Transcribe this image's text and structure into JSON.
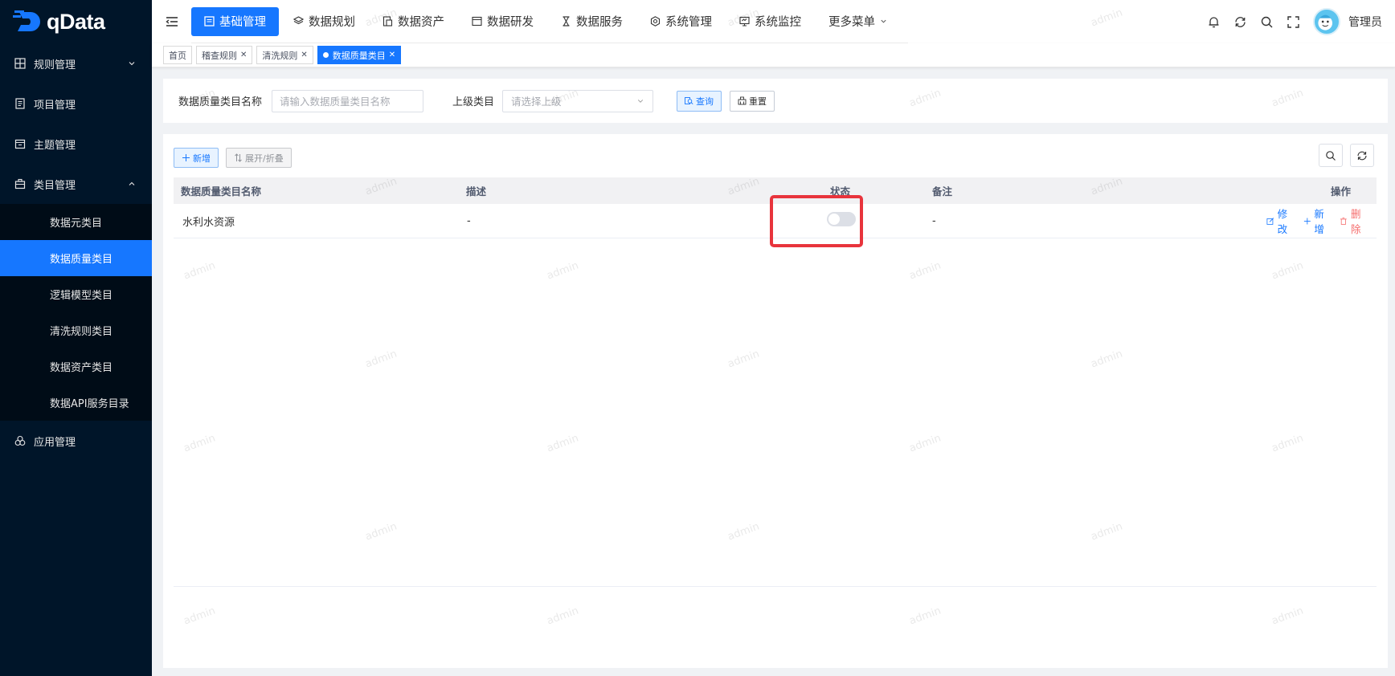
{
  "app": {
    "name": "qData"
  },
  "sidebar": {
    "items": [
      {
        "label": "规则管理",
        "icon": "grid-icon",
        "expandable": true
      },
      {
        "label": "项目管理",
        "icon": "document-icon"
      },
      {
        "label": "主题管理",
        "icon": "calendar-icon"
      },
      {
        "label": "类目管理",
        "icon": "briefcase-icon",
        "expanded": true,
        "children": [
          "数据元类目",
          "数据质量类目",
          "逻辑模型类目",
          "清洗规则类目",
          "数据资产类目",
          "数据API服务目录"
        ]
      },
      {
        "label": "应用管理",
        "icon": "apps-icon"
      }
    ],
    "active_child": "数据质量类目"
  },
  "topnav": {
    "items": [
      {
        "label": "基础管理",
        "icon": "base-icon",
        "active": true
      },
      {
        "label": "数据规划",
        "icon": "layers-icon"
      },
      {
        "label": "数据资产",
        "icon": "asset-icon"
      },
      {
        "label": "数据研发",
        "icon": "window-icon"
      },
      {
        "label": "数据服务",
        "icon": "hourglass-icon"
      },
      {
        "label": "系统管理",
        "icon": "gear-icon"
      },
      {
        "label": "系统监控",
        "icon": "monitor-icon"
      },
      {
        "label": "更多菜单",
        "icon": "chevron-down-icon"
      }
    ]
  },
  "header": {
    "username": "管理员"
  },
  "tags": [
    {
      "label": "首页",
      "closable": false
    },
    {
      "label": "稽查规则",
      "closable": true
    },
    {
      "label": "清洗规则",
      "closable": true
    },
    {
      "label": "数据质量类目",
      "closable": true,
      "active": true
    }
  ],
  "search": {
    "name_label": "数据质量类目名称",
    "name_placeholder": "请输入数据质量类目名称",
    "parent_label": "上级类目",
    "parent_placeholder": "请选择上级",
    "query_button": "查询",
    "reset_button": "重置"
  },
  "toolbar": {
    "add_button": "新增",
    "expand_button": "展开/折叠"
  },
  "table": {
    "columns": [
      "数据质量类目名称",
      "描述",
      "状态",
      "备注",
      "操作"
    ],
    "rows": [
      {
        "name": "水利水资源",
        "desc": "-",
        "status": false,
        "remark": "-"
      }
    ],
    "actions": {
      "edit": "修改",
      "add": "新增",
      "delete": "删除"
    }
  },
  "watermark": "admin",
  "colors": {
    "primary": "#1677ff",
    "sidebar": "#001529",
    "danger": "#f56c6c",
    "highlight": "#e8343c"
  }
}
